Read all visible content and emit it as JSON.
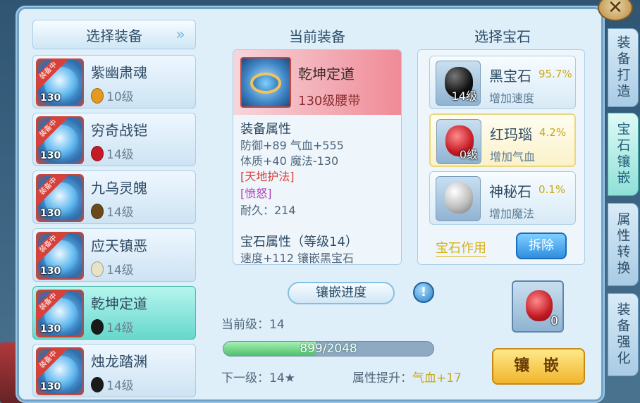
{
  "left_list": {
    "header": "选择装备",
    "items": [
      {
        "name": "紫幽肃魂",
        "badge": "装备中",
        "level": "130",
        "gem_level": "10级",
        "gem_color": "#e39a1f"
      },
      {
        "name": "穷奇战铠",
        "badge": "装备中",
        "level": "130",
        "gem_level": "14级",
        "gem_color": "#c41b25"
      },
      {
        "name": "九乌灵魄",
        "badge": "装备中",
        "level": "130",
        "gem_level": "14级",
        "gem_color": "#6a4a18"
      },
      {
        "name": "应天镇恶",
        "badge": "装备中",
        "level": "130",
        "gem_level": "14级",
        "gem_color": "#e7e2c8"
      },
      {
        "name": "乾坤定道",
        "badge": "装备中",
        "level": "130",
        "gem_level": "14级",
        "gem_color": "#1a1a1a"
      },
      {
        "name": "烛龙踏渊",
        "badge": "装备中",
        "level": "130",
        "gem_level": "14级",
        "gem_color": "#1a1a1a"
      }
    ]
  },
  "current": {
    "title": "当前装备",
    "name": "乾坤定道",
    "type": "130级腰带",
    "attr_head": "装备属性",
    "attr1": "防御+89 气血+555",
    "attr2": "体质+40 魔法-130",
    "special1": "[天地护法]",
    "special2": "[愤怒]",
    "durability": "耐久：214",
    "gem_attr_head": "宝石属性（等级14）",
    "gem_attr_line": "速度+112 镶嵌黑宝石"
  },
  "gems": {
    "title": "选择宝石",
    "cards": [
      {
        "name": "黑宝石",
        "pct": "95.7%",
        "count": "14级",
        "effect": "增加速度",
        "color": "#111"
      },
      {
        "name": "红玛瑙",
        "pct": "4.2%",
        "count": "0级",
        "effect": "增加气血",
        "color": "#c41b25"
      },
      {
        "name": "神秘石",
        "pct": "0.1%",
        "count": "",
        "effect": "增加魔法",
        "color": "#bfbfbf"
      }
    ],
    "func_link": "宝石作用",
    "dismantle": "拆除"
  },
  "progress": {
    "title": "镶嵌进度",
    "current_level": "当前级：14",
    "value_text": "899/2048",
    "fraction": 0.439,
    "next_level": "下一级：14★",
    "attr_up_label": "属性提升：",
    "attr_up_value": "气血+17"
  },
  "result": {
    "count": "0"
  },
  "embed_button": "镶 嵌",
  "side_tabs": [
    "装备打造",
    "宝石镶嵌",
    "属性转换",
    "装备强化"
  ],
  "close_icon": "✕"
}
